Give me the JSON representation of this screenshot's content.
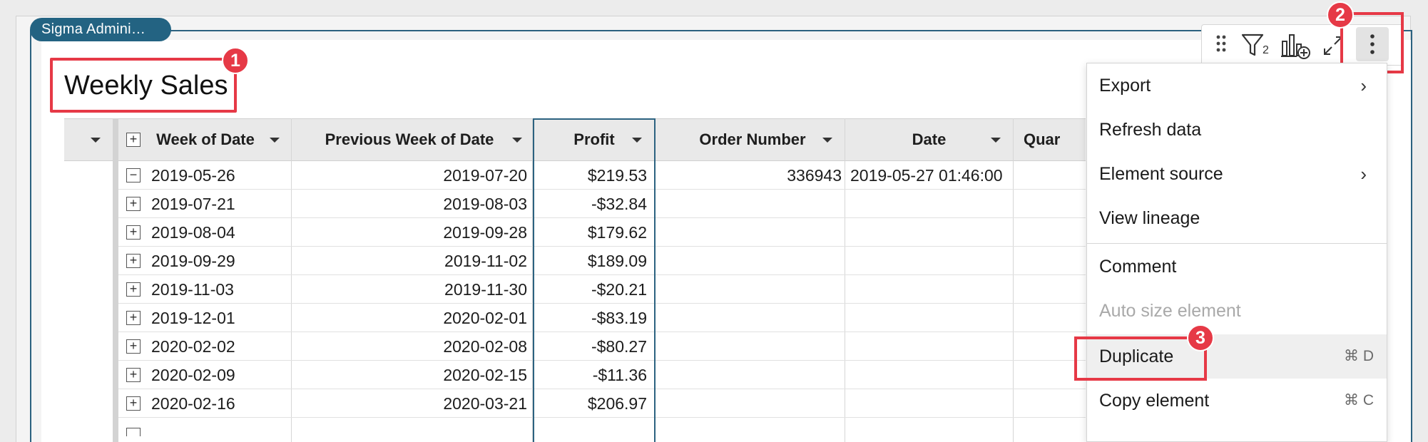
{
  "chip": {
    "label": "Sigma Admini…"
  },
  "element": {
    "title": "Weekly Sales"
  },
  "annotations": {
    "b1": "1",
    "b2": "2",
    "b3": "3"
  },
  "toolbar": {
    "filter_count": "2"
  },
  "table": {
    "columns": [
      {
        "label": "Week of Date"
      },
      {
        "label": "Previous Week of Date"
      },
      {
        "label": "Profit"
      },
      {
        "label": "Order Number"
      },
      {
        "label": "Date"
      },
      {
        "label": "Quar"
      }
    ],
    "rows": [
      {
        "week": "2019-05-26",
        "prev": "2019-07-20",
        "profit": "$219.53",
        "order": "336943",
        "date": "2019-05-27 01:46:00",
        "expanded": true
      },
      {
        "week": "2019-07-21",
        "prev": "2019-08-03",
        "profit": "-$32.84",
        "order": "",
        "date": ""
      },
      {
        "week": "2019-08-04",
        "prev": "2019-09-28",
        "profit": "$179.62",
        "order": "",
        "date": ""
      },
      {
        "week": "2019-09-29",
        "prev": "2019-11-02",
        "profit": "$189.09",
        "order": "",
        "date": ""
      },
      {
        "week": "2019-11-03",
        "prev": "2019-11-30",
        "profit": "-$20.21",
        "order": "",
        "date": ""
      },
      {
        "week": "2019-12-01",
        "prev": "2020-02-01",
        "profit": "-$83.19",
        "order": "",
        "date": ""
      },
      {
        "week": "2020-02-02",
        "prev": "2020-02-08",
        "profit": "-$80.27",
        "order": "",
        "date": ""
      },
      {
        "week": "2020-02-09",
        "prev": "2020-02-15",
        "profit": "-$11.36",
        "order": "",
        "date": ""
      },
      {
        "week": "2020-02-16",
        "prev": "2020-03-21",
        "profit": "$206.97",
        "order": "",
        "date": ""
      }
    ]
  },
  "menu": {
    "items": [
      {
        "label": "Export",
        "submenu": true
      },
      {
        "label": "Refresh data"
      },
      {
        "label": "Element source",
        "submenu": true
      },
      {
        "label": "View lineage"
      },
      {
        "label": "Comment"
      },
      {
        "label": "Auto size element",
        "disabled": true
      },
      {
        "label": "Duplicate",
        "shortcut": "⌘ D"
      },
      {
        "label": "Copy element",
        "shortcut": "⌘ C"
      }
    ]
  },
  "colors": {
    "accent": "#236382",
    "annotation": "#e63946"
  }
}
